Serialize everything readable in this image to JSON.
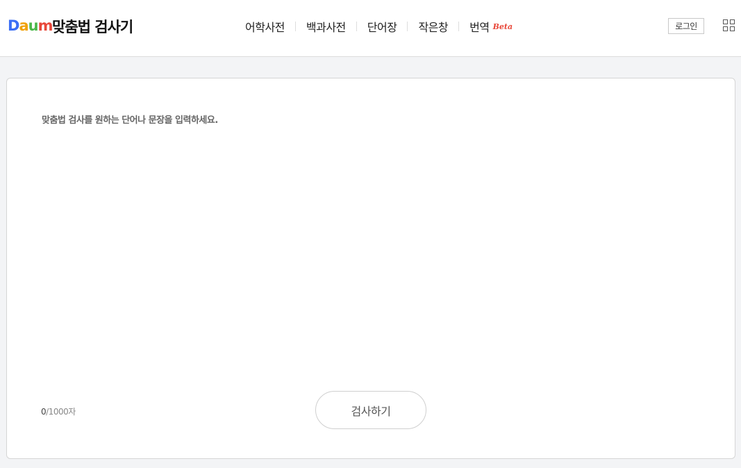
{
  "header": {
    "logo_letters": [
      {
        "char": "D",
        "color": "#3b6ef5"
      },
      {
        "char": "a",
        "color": "#f0a20a"
      },
      {
        "char": "u",
        "color": "#4bb84a"
      },
      {
        "char": "m",
        "color": "#e8483a"
      }
    ],
    "service_title": "맞춤법 검사기",
    "nav": [
      {
        "label": "어학사전"
      },
      {
        "label": "백과사전"
      },
      {
        "label": "단어장"
      },
      {
        "label": "작은창"
      },
      {
        "label": "번역",
        "badge": "Beta"
      }
    ],
    "login_label": "로그인",
    "apps_icon": "grid-icon"
  },
  "editor": {
    "placeholder": "맞춤법 검사를 원하는 단어나 문장을 입력하세요.",
    "value": ""
  },
  "counter": {
    "current": "0",
    "limit": "/1000자"
  },
  "check_button_label": "검사하기",
  "colors": {
    "background": "#f3f4f6",
    "card": "#ffffff",
    "beta": "#e8483a"
  }
}
